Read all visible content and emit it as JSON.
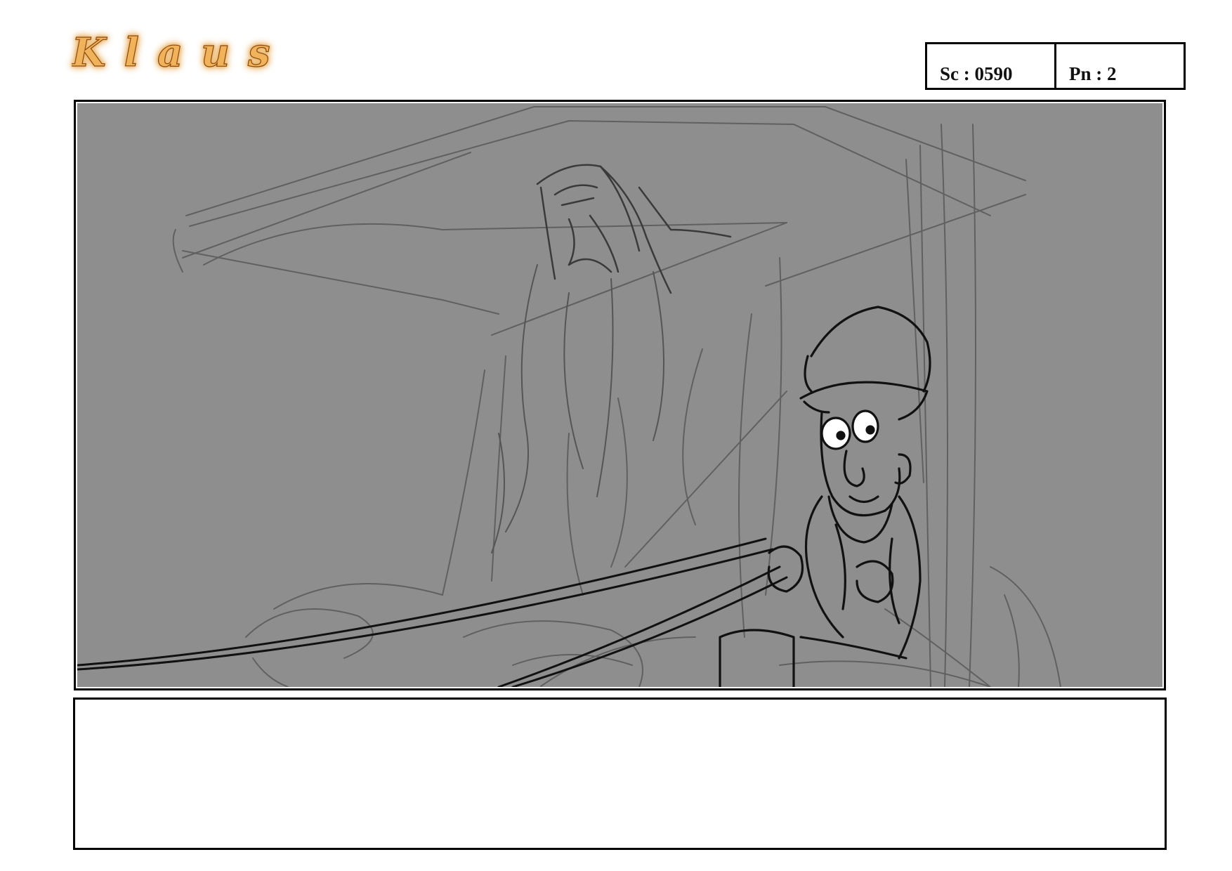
{
  "brand": {
    "logo_text": "Klaus"
  },
  "header": {
    "scene": "Sc : 0590",
    "panel": "Pn : 2"
  },
  "notes": {
    "text": ""
  },
  "colors": {
    "panel_bg": "#8e8e8e",
    "rough_line": "#5c5c5c",
    "ink_line": "#111111",
    "logo_gold": "#f0b25a"
  }
}
